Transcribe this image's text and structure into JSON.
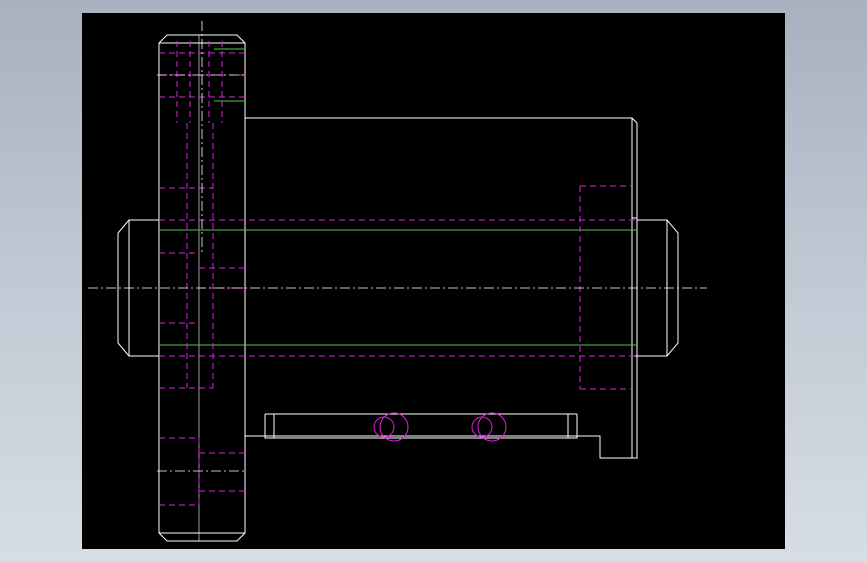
{
  "viewport": {
    "background": "#000000"
  },
  "colors": {
    "page_background": "#b8c1cd",
    "outline": "#ffffff",
    "hidden_lines": "#e020e0",
    "thread_lines": "#40d040",
    "center_lines": "#ffffff"
  },
  "line_styles": {
    "hidden": "dashed",
    "center": "dash-dot"
  },
  "drawing": {
    "view": "front-section",
    "parts": [
      {
        "id": "flange",
        "name": "flange-outline"
      },
      {
        "id": "nut-body",
        "name": "nut-body-outline"
      },
      {
        "id": "screw-left",
        "name": "screw-left-end"
      },
      {
        "id": "screw-right",
        "name": "screw-right-end"
      },
      {
        "id": "wiper-channel",
        "name": "bottom-channel"
      }
    ]
  }
}
